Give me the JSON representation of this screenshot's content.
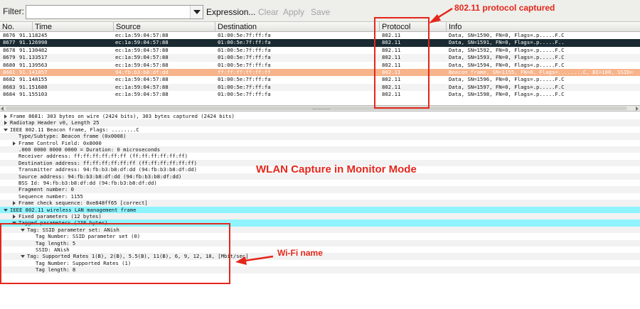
{
  "toolbar": {
    "filter_label": "Filter:",
    "filter_value": "",
    "expression_label": "Expression...",
    "clear_label": "Clear",
    "apply_label": "Apply",
    "save_label": "Save"
  },
  "packet_list": {
    "columns": [
      "No.",
      "Time",
      "Source",
      "Destination",
      "Protocol",
      "Info"
    ],
    "rows": [
      {
        "no": "8676",
        "time": "91.118245",
        "source": "ec:1a:59:04:57:88",
        "destination": "01:00:5e:7f:ff:fa",
        "protocol": "802.11",
        "info": "Data, SN=1590, FN=0, Flags=.p.....F.C",
        "style": "normal"
      },
      {
        "no": "8677",
        "time": "91.126990",
        "source": "ec:1a:59:04:57:88",
        "destination": "01:00:5e:7f:ff:fa",
        "protocol": "802.11",
        "info": "Data, SN=1591, FN=0, Flags=.p.....F..",
        "style": "dark"
      },
      {
        "no": "8678",
        "time": "91.130482",
        "source": "ec:1a:59:04:57:88",
        "destination": "01:00:5e:7f:ff:fa",
        "protocol": "802.11",
        "info": "Data, SN=1592, FN=0, Flags=.p.....F.C",
        "style": "normal"
      },
      {
        "no": "8679",
        "time": "91.133517",
        "source": "ec:1a:59:04:57:88",
        "destination": "01:00:5e:7f:ff:fa",
        "protocol": "802.11",
        "info": "Data, SN=1593, FN=0, Flags=.p.....F.C",
        "style": "normal"
      },
      {
        "no": "8680",
        "time": "91.139563",
        "source": "ec:1a:59:04:57:88",
        "destination": "01:00:5e:7f:ff:fa",
        "protocol": "802.11",
        "info": "Data, SN=1594, FN=0, Flags=.p.....F.C",
        "style": "normal"
      },
      {
        "no": "8681",
        "time": "91.141057",
        "source": "94:fb:b3:b8:df:dd",
        "destination": "ff:ff:ff:ff:ff:ff",
        "protocol": "802.11",
        "info": "Beacon frame, SN=1155, FN=0, Flags=........C, BI=100, SSID=",
        "style": "selected"
      },
      {
        "no": "8682",
        "time": "91.148155",
        "source": "ec:1a:59:04:57:88",
        "destination": "01:00:5e:7f:ff:fa",
        "protocol": "802.11",
        "info": "Data, SN=1596, FN=0, Flags=.p.....F.C",
        "style": "normal"
      },
      {
        "no": "8683",
        "time": "91.151680",
        "source": "ec:1a:59:04:57:88",
        "destination": "01:00:5e:7f:ff:fa",
        "protocol": "802.11",
        "info": "Data, SN=1597, FN=0, Flags=.p.....F.C",
        "style": "normal"
      },
      {
        "no": "8684",
        "time": "91.155103",
        "source": "ec:1a:59:04:57:88",
        "destination": "01:00:5e:7f:ff:fa",
        "protocol": "802.11",
        "info": "Data, SN=1598, FN=0, Flags=.p.....F.C",
        "style": "normal"
      }
    ]
  },
  "details": [
    {
      "indent": 0,
      "toggle": "closed",
      "text": "Frame 8681: 303 bytes on wire (2424 bits), 303 bytes captured (2424 bits)",
      "hl": false
    },
    {
      "indent": 0,
      "toggle": "closed",
      "text": "Radiotap Header v0, Length 25",
      "hl": false
    },
    {
      "indent": 0,
      "toggle": "open",
      "text": "IEEE 802.11 Beacon frame, Flags: ........C",
      "hl": false
    },
    {
      "indent": 1,
      "toggle": "none",
      "text": "Type/Subtype: Beacon frame (0x0008)",
      "hl": false
    },
    {
      "indent": 1,
      "toggle": "closed",
      "text": "Frame Control Field: 0x8000",
      "hl": false
    },
    {
      "indent": 1,
      "toggle": "none",
      "text": ".000 0000 0000 0000 = Duration: 0 microseconds",
      "hl": false
    },
    {
      "indent": 1,
      "toggle": "none",
      "text": "Receiver address: ff:ff:ff:ff:ff:ff (ff:ff:ff:ff:ff:ff)",
      "hl": false
    },
    {
      "indent": 1,
      "toggle": "none",
      "text": "Destination address: ff:ff:ff:ff:ff:ff (ff:ff:ff:ff:ff:ff)",
      "hl": false
    },
    {
      "indent": 1,
      "toggle": "none",
      "text": "Transmitter address: 94:fb:b3:b8:df:dd (94:fb:b3:b8:df:dd)",
      "hl": false
    },
    {
      "indent": 1,
      "toggle": "none",
      "text": "Source address: 94:fb:b3:b8:df:dd (94:fb:b3:b8:df:dd)",
      "hl": false
    },
    {
      "indent": 1,
      "toggle": "none",
      "text": "BSS Id: 94:fb:b3:b8:df:dd (94:fb:b3:b8:df:dd)",
      "hl": false
    },
    {
      "indent": 1,
      "toggle": "none",
      "text": "Fragment number: 0",
      "hl": false
    },
    {
      "indent": 1,
      "toggle": "none",
      "text": "Sequence number: 1155",
      "hl": false
    },
    {
      "indent": 1,
      "toggle": "closed",
      "text": "Frame check sequence: 0xe848ff65 [correct]",
      "hl": false
    },
    {
      "indent": 0,
      "toggle": "open",
      "text": "IEEE 802.11 wireless LAN management frame",
      "hl": true
    },
    {
      "indent": 1,
      "toggle": "closed",
      "text": "Fixed parameters (12 bytes)",
      "hl": false
    },
    {
      "indent": 1,
      "toggle": "open",
      "text": "Tagged parameters (238 bytes)",
      "hl": true
    },
    {
      "indent": 2,
      "toggle": "open",
      "text": "Tag: SSID parameter set: ANish",
      "hl": false
    },
    {
      "indent": 3,
      "toggle": "none",
      "text": "Tag Number: SSID parameter set (0)",
      "hl": false
    },
    {
      "indent": 3,
      "toggle": "none",
      "text": "Tag length: 5",
      "hl": false
    },
    {
      "indent": 3,
      "toggle": "none",
      "text": "SSID: ANish",
      "hl": false
    },
    {
      "indent": 2,
      "toggle": "open",
      "text": "Tag: Supported Rates 1(B), 2(B), 5.5(B), 11(B), 6, 9, 12, 18, [Mbit/sec]",
      "hl": false
    },
    {
      "indent": 3,
      "toggle": "none",
      "text": "Tag Number: Supported Rates (1)",
      "hl": false
    },
    {
      "indent": 3,
      "toggle": "none",
      "text": "Tag length: 8",
      "hl": false
    }
  ],
  "annotations": {
    "protocol_note": "802.11 protocol captured",
    "main_caption": "WLAN Capture in Monitor Mode",
    "wifi_note": "Wi-Fi name"
  },
  "colors": {
    "accent_red": "#e4261b",
    "selected_row": "#f7b38a",
    "dark_row": "#1a2a33",
    "highlight_cyan": "#8ff4ff"
  }
}
